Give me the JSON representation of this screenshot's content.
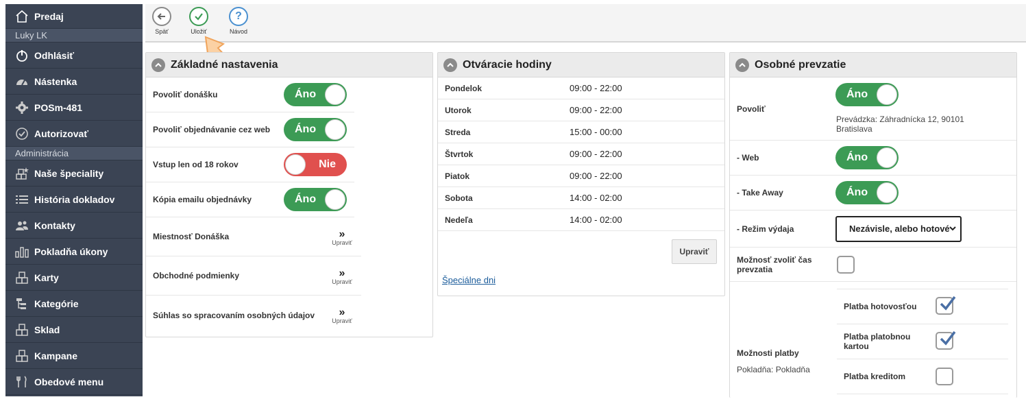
{
  "sidebar": {
    "items": [
      {
        "label": "Predaj",
        "icon": "home-icon"
      },
      {
        "header": "Luky LK"
      },
      {
        "label": "Odhlásiť",
        "icon": "power-icon"
      },
      {
        "label": "Nástenka",
        "icon": "dashboard-icon"
      },
      {
        "label": "POSm-481",
        "icon": "gear-icon"
      },
      {
        "label": "Autorizovať",
        "icon": "check-circle-icon"
      },
      {
        "header": "Administrácia"
      },
      {
        "label": "Naše špeciality",
        "icon": "boxes-star-icon"
      },
      {
        "label": "História dokladov",
        "icon": "list-icon"
      },
      {
        "label": "Kontakty",
        "icon": "users-icon"
      },
      {
        "label": "Pokladňa úkony",
        "icon": "bars-icon"
      },
      {
        "label": "Karty",
        "icon": "boxes-icon"
      },
      {
        "label": "Kategórie",
        "icon": "tree-icon"
      },
      {
        "label": "Sklad",
        "icon": "boxes-icon"
      },
      {
        "label": "Kampane",
        "icon": "boxes-icon"
      },
      {
        "label": "Obedové menu",
        "icon": "cutlery-icon"
      }
    ]
  },
  "toolbar": {
    "back": "Späť",
    "save": "Uložiť",
    "help": "Návod"
  },
  "basic": {
    "title": "Základné nastavenia",
    "rows": [
      {
        "label": "Povoliť donášku",
        "toggle": "Áno",
        "on": true
      },
      {
        "label": "Povoliť objednávanie cez web",
        "toggle": "Áno",
        "on": true
      },
      {
        "label": "Vstup len od 18 rokov",
        "toggle": "Nie",
        "on": false
      },
      {
        "label": "Kópia emailu objednávky",
        "toggle": "Áno",
        "on": true
      },
      {
        "label": "Miestnosť Donáška",
        "edit": "Upraviť"
      },
      {
        "label": "Obchodné podmienky",
        "edit": "Upraviť"
      },
      {
        "label": "Súhlas so spracovaním osobných údajov",
        "edit": "Upraviť"
      }
    ]
  },
  "hours": {
    "title": "Otváracie hodiny",
    "days": [
      {
        "day": "Pondelok",
        "time": "09:00 - 22:00"
      },
      {
        "day": "Utorok",
        "time": "09:00 - 22:00"
      },
      {
        "day": "Streda",
        "time": "15:00 - 00:00"
      },
      {
        "day": "Štvrtok",
        "time": "09:00 - 22:00"
      },
      {
        "day": "Piatok",
        "time": "09:00 - 22:00"
      },
      {
        "day": "Sobota",
        "time": "14:00 - 02:00"
      },
      {
        "day": "Nedeľa",
        "time": "14:00 - 02:00"
      }
    ],
    "edit_button": "Upraviť",
    "special_link": "Špeciálne dni"
  },
  "pickup": {
    "title": "Osobné prevzatie",
    "allow_label": "Povoliť",
    "allow_toggle": "Áno",
    "shop_line1": "Prevádzka: Záhradnícka 12, 90101",
    "shop_line2": "Bratislava",
    "web_label": "- Web",
    "web_toggle": "Áno",
    "takeaway_label": "- Take Away",
    "takeaway_toggle": "Áno",
    "mode_label": "- Režim výdaja",
    "mode_value": "Nezávisle, alebo hotové",
    "time_label_1": "Možnosť zvoliť čas",
    "time_label_2": "prevzatia",
    "payment_label": "Možnosti platby",
    "payment_sub": "Pokladňa: Pokladňa",
    "payments": [
      {
        "label": "Platba hotovosťou",
        "checked": true
      },
      {
        "label": "Platba platobnou kartou",
        "checked": true
      },
      {
        "label": "Platba kreditom",
        "checked": false
      }
    ]
  },
  "colors": {
    "sidebar": "#3b4454",
    "toggle_on": "#3c9b55",
    "toggle_off": "#e0504e",
    "link": "#1a5b9a",
    "check": "#4a6fa5"
  }
}
